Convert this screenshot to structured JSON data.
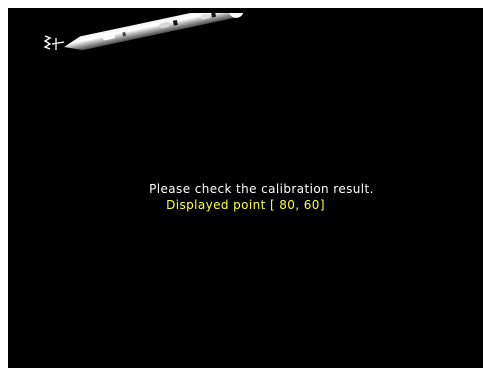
{
  "screen": {
    "background_color": "#000000",
    "stylus_icon": "stylus-pen-icon",
    "instruction_text": "Please check the calibration result.",
    "instruction_color": "#ffffff",
    "point_text": "Displayed point [ 80, 60]",
    "point_color": "#ffff3a"
  }
}
